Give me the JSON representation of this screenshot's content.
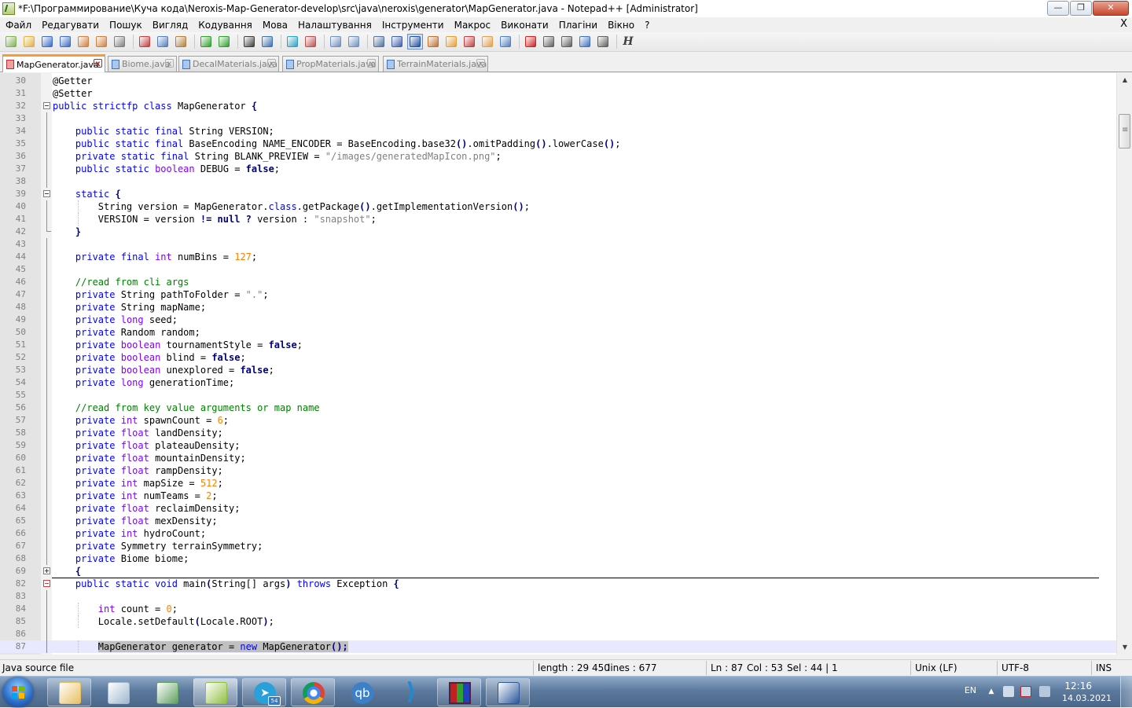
{
  "window": {
    "title": "*F:\\Программирование\\Куча кода\\Neroxis-Map-Generator-develop\\src\\java\\neroxis\\generator\\MapGenerator.java - Notepad++ [Administrator]",
    "minimize": "0",
    "maximize": "1",
    "close": "r"
  },
  "menu": [
    "Файл",
    "Редагувати",
    "Пошук",
    "Вигляд",
    "Кодування",
    "Мова",
    "Налаштування",
    "Інструменти",
    "Макрос",
    "Виконати",
    "Плагіни",
    "Вікно",
    "?"
  ],
  "menu_close": "X",
  "toolbar": [
    {
      "name": "new-file-icon",
      "color": "#7fb05a"
    },
    {
      "name": "open-file-icon",
      "color": "#e0b040"
    },
    {
      "name": "save-icon",
      "color": "#3c6cc8"
    },
    {
      "name": "save-all-icon",
      "color": "#3c6cc8"
    },
    {
      "name": "close-file-icon",
      "color": "#d08040"
    },
    {
      "name": "close-all-icon",
      "color": "#d08040"
    },
    {
      "name": "print-icon",
      "color": "#808080"
    },
    {
      "sep": true
    },
    {
      "name": "cut-icon",
      "color": "#c04040"
    },
    {
      "name": "copy-icon",
      "color": "#5080c0"
    },
    {
      "name": "paste-icon",
      "color": "#b08040"
    },
    {
      "sep": true
    },
    {
      "name": "undo-icon",
      "color": "#30a030"
    },
    {
      "name": "redo-icon",
      "color": "#30a030"
    },
    {
      "sep": true
    },
    {
      "name": "find-icon",
      "color": "#404040"
    },
    {
      "name": "replace-icon",
      "color": "#4070b0"
    },
    {
      "sep": true
    },
    {
      "name": "zoom-in-icon",
      "color": "#30a0c0"
    },
    {
      "name": "zoom-out-icon",
      "color": "#c05050"
    },
    {
      "sep": true
    },
    {
      "name": "sync-vertical-icon",
      "color": "#7090c0"
    },
    {
      "name": "sync-horizontal-icon",
      "color": "#7090c0"
    },
    {
      "sep": true
    },
    {
      "name": "word-wrap-icon",
      "color": "#5070a0"
    },
    {
      "name": "show-all-chars-icon",
      "color": "#4060b0"
    },
    {
      "name": "indent-guide-icon",
      "color": "#2050a0",
      "active": true
    },
    {
      "name": "udl-icon",
      "color": "#c07030"
    },
    {
      "name": "doc-map-icon",
      "color": "#e0a040"
    },
    {
      "name": "function-list-icon",
      "color": "#c04040"
    },
    {
      "name": "folder-workspace-icon",
      "color": "#e0a050"
    },
    {
      "name": "monitoring-icon",
      "color": "#5080c0"
    },
    {
      "sep": true
    },
    {
      "name": "record-macro-icon",
      "color": "#d02020"
    },
    {
      "name": "stop-recording-icon",
      "color": "#606060"
    },
    {
      "name": "playback-icon",
      "color": "#606060"
    },
    {
      "name": "run-macro-multiple-icon",
      "color": "#4070c0"
    },
    {
      "name": "save-macro-icon",
      "color": "#606060"
    },
    {
      "sep": true
    },
    {
      "name": "hex-editor-icon",
      "color": "#404040",
      "glyph": "H"
    }
  ],
  "tabs": [
    {
      "label": "MapGenerator.java",
      "active": true
    },
    {
      "label": "Biome.java",
      "active": false
    },
    {
      "label": "DecalMaterials.java",
      "active": false
    },
    {
      "label": "PropMaterials.java",
      "active": false
    },
    {
      "label": "TerrainMaterials.java",
      "active": false
    }
  ],
  "tab_close": "x",
  "code_lines": [
    {
      "n": "30",
      "fold": "",
      "text": [
        [
          "@Getter",
          ""
        ]
      ]
    },
    {
      "n": "31",
      "fold": "",
      "text": [
        [
          "@Setter",
          ""
        ]
      ]
    },
    {
      "n": "32",
      "fold": "minus",
      "text": [
        [
          "public strictfp class",
          "kw"
        ],
        [
          " MapGenerator ",
          ""
        ],
        [
          "{",
          "op"
        ]
      ]
    },
    {
      "n": "33",
      "fold": "line",
      "text": []
    },
    {
      "n": "34",
      "fold": "line",
      "text": [
        [
          "    public static final",
          "kw"
        ],
        [
          " String VERSION;",
          ""
        ]
      ]
    },
    {
      "n": "35",
      "fold": "line",
      "text": [
        [
          "    public static final",
          "kw"
        ],
        [
          " BaseEncoding NAME_ENCODER = BaseEncoding.base32",
          ""
        ],
        [
          "()",
          "op"
        ],
        [
          ".omitPadding",
          ""
        ],
        [
          "()",
          "op"
        ],
        [
          ".lowerCase",
          ""
        ],
        [
          "()",
          "op"
        ],
        [
          ";",
          ""
        ]
      ]
    },
    {
      "n": "36",
      "fold": "line",
      "text": [
        [
          "    private static final",
          "kw"
        ],
        [
          " String BLANK_PREVIEW = ",
          ""
        ],
        [
          "\"/images/generatedMapIcon.png\"",
          "st"
        ],
        [
          ";",
          ""
        ]
      ]
    },
    {
      "n": "37",
      "fold": "line",
      "text": [
        [
          "    public static",
          "kw"
        ],
        [
          " ",
          ""
        ],
        [
          "boolean",
          "ty"
        ],
        [
          " DEBUG = ",
          ""
        ],
        [
          "false",
          "op"
        ],
        [
          ";",
          ""
        ]
      ]
    },
    {
      "n": "38",
      "fold": "line",
      "text": []
    },
    {
      "n": "39",
      "fold": "minus",
      "text": [
        [
          "    static",
          "kw"
        ],
        [
          " ",
          ""
        ],
        [
          "{",
          "op"
        ]
      ]
    },
    {
      "n": "40",
      "fold": "line",
      "text": [
        [
          "        String version = MapGenerator.",
          ""
        ],
        [
          "class",
          "kw"
        ],
        [
          ".getPackage",
          ""
        ],
        [
          "()",
          "op"
        ],
        [
          ".getImplementationVersion",
          ""
        ],
        [
          "()",
          "op"
        ],
        [
          ";",
          ""
        ]
      ]
    },
    {
      "n": "41",
      "fold": "line",
      "text": [
        [
          "        VERSION = version ",
          ""
        ],
        [
          "!= null ?",
          "op"
        ],
        [
          " version : ",
          ""
        ],
        [
          "\"snapshot\"",
          "st"
        ],
        [
          ";",
          ""
        ]
      ]
    },
    {
      "n": "42",
      "fold": "end",
      "text": [
        [
          "    ",
          ""
        ],
        [
          "}",
          "op"
        ]
      ]
    },
    {
      "n": "43",
      "fold": "line",
      "text": []
    },
    {
      "n": "44",
      "fold": "line",
      "text": [
        [
          "    private final",
          "kw"
        ],
        [
          " ",
          ""
        ],
        [
          "int",
          "ty"
        ],
        [
          " numBins = ",
          ""
        ],
        [
          "127",
          "nm"
        ],
        [
          ";",
          ""
        ]
      ]
    },
    {
      "n": "45",
      "fold": "line",
      "text": []
    },
    {
      "n": "46",
      "fold": "line",
      "text": [
        [
          "    //read from cli args",
          "cm"
        ]
      ]
    },
    {
      "n": "47",
      "fold": "line",
      "text": [
        [
          "    private",
          "kw"
        ],
        [
          " String pathToFolder = ",
          ""
        ],
        [
          "\".\"",
          "st"
        ],
        [
          ";",
          ""
        ]
      ]
    },
    {
      "n": "48",
      "fold": "line",
      "text": [
        [
          "    private",
          "kw"
        ],
        [
          " String mapName;",
          ""
        ]
      ]
    },
    {
      "n": "49",
      "fold": "line",
      "text": [
        [
          "    private",
          "kw"
        ],
        [
          " ",
          ""
        ],
        [
          "long",
          "ty"
        ],
        [
          " seed;",
          ""
        ]
      ]
    },
    {
      "n": "50",
      "fold": "line",
      "text": [
        [
          "    private",
          "kw"
        ],
        [
          " Random random;",
          ""
        ]
      ]
    },
    {
      "n": "51",
      "fold": "line",
      "text": [
        [
          "    private",
          "kw"
        ],
        [
          " ",
          ""
        ],
        [
          "boolean",
          "ty"
        ],
        [
          " tournamentStyle = ",
          ""
        ],
        [
          "false",
          "op"
        ],
        [
          ";",
          ""
        ]
      ]
    },
    {
      "n": "52",
      "fold": "line",
      "text": [
        [
          "    private",
          "kw"
        ],
        [
          " ",
          ""
        ],
        [
          "boolean",
          "ty"
        ],
        [
          " blind = ",
          ""
        ],
        [
          "false",
          "op"
        ],
        [
          ";",
          ""
        ]
      ]
    },
    {
      "n": "53",
      "fold": "line",
      "text": [
        [
          "    private",
          "kw"
        ],
        [
          " ",
          ""
        ],
        [
          "boolean",
          "ty"
        ],
        [
          " unexplored = ",
          ""
        ],
        [
          "false",
          "op"
        ],
        [
          ";",
          ""
        ]
      ]
    },
    {
      "n": "54",
      "fold": "line",
      "text": [
        [
          "    private",
          "kw"
        ],
        [
          " ",
          ""
        ],
        [
          "long",
          "ty"
        ],
        [
          " generationTime;",
          ""
        ]
      ]
    },
    {
      "n": "55",
      "fold": "line",
      "text": []
    },
    {
      "n": "56",
      "fold": "line",
      "text": [
        [
          "    //read from key value arguments or map name",
          "cm"
        ]
      ]
    },
    {
      "n": "57",
      "fold": "line",
      "text": [
        [
          "    private",
          "kw"
        ],
        [
          " ",
          ""
        ],
        [
          "int",
          "ty"
        ],
        [
          " spawnCount = ",
          ""
        ],
        [
          "6",
          "nm"
        ],
        [
          ";",
          ""
        ]
      ]
    },
    {
      "n": "58",
      "fold": "line",
      "text": [
        [
          "    private",
          "kw"
        ],
        [
          " ",
          ""
        ],
        [
          "float",
          "ty"
        ],
        [
          " landDensity;",
          ""
        ]
      ]
    },
    {
      "n": "59",
      "fold": "line",
      "text": [
        [
          "    private",
          "kw"
        ],
        [
          " ",
          ""
        ],
        [
          "float",
          "ty"
        ],
        [
          " plateauDensity;",
          ""
        ]
      ]
    },
    {
      "n": "60",
      "fold": "line",
      "text": [
        [
          "    private",
          "kw"
        ],
        [
          " ",
          ""
        ],
        [
          "float",
          "ty"
        ],
        [
          " mountainDensity;",
          ""
        ]
      ]
    },
    {
      "n": "61",
      "fold": "line",
      "text": [
        [
          "    private",
          "kw"
        ],
        [
          " ",
          ""
        ],
        [
          "float",
          "ty"
        ],
        [
          " rampDensity;",
          ""
        ]
      ]
    },
    {
      "n": "62",
      "fold": "line",
      "text": [
        [
          "    private",
          "kw"
        ],
        [
          " ",
          ""
        ],
        [
          "int",
          "ty"
        ],
        [
          " mapSize = ",
          ""
        ],
        [
          "512",
          "nm"
        ],
        [
          ";",
          ""
        ]
      ]
    },
    {
      "n": "63",
      "fold": "line",
      "text": [
        [
          "    private",
          "kw"
        ],
        [
          " ",
          ""
        ],
        [
          "int",
          "ty"
        ],
        [
          " numTeams = ",
          ""
        ],
        [
          "2",
          "nm"
        ],
        [
          ";",
          ""
        ]
      ]
    },
    {
      "n": "64",
      "fold": "line",
      "text": [
        [
          "    private",
          "kw"
        ],
        [
          " ",
          ""
        ],
        [
          "float",
          "ty"
        ],
        [
          " reclaimDensity;",
          ""
        ]
      ]
    },
    {
      "n": "65",
      "fold": "line",
      "text": [
        [
          "    private",
          "kw"
        ],
        [
          " ",
          ""
        ],
        [
          "float",
          "ty"
        ],
        [
          " mexDensity;",
          ""
        ]
      ]
    },
    {
      "n": "66",
      "fold": "line",
      "text": [
        [
          "    private",
          "kw"
        ],
        [
          " ",
          ""
        ],
        [
          "int",
          "ty"
        ],
        [
          " hydroCount;",
          ""
        ]
      ]
    },
    {
      "n": "67",
      "fold": "line",
      "text": [
        [
          "    private",
          "kw"
        ],
        [
          " Symmetry terrainSymmetry;",
          ""
        ]
      ]
    },
    {
      "n": "68",
      "fold": "line",
      "text": [
        [
          "    private",
          "kw"
        ],
        [
          " Biome biome;",
          ""
        ]
      ]
    },
    {
      "n": "69",
      "fold": "plus",
      "sep": true,
      "text": [
        [
          "    ",
          ""
        ],
        [
          "{",
          "op"
        ]
      ]
    },
    {
      "n": "82",
      "fold": "minus-red",
      "text": [
        [
          "    public static void",
          "kw"
        ],
        [
          " main",
          ""
        ],
        [
          "(",
          "op"
        ],
        [
          "String[] args",
          ""
        ],
        [
          ")",
          "op"
        ],
        [
          " ",
          ""
        ],
        [
          "throws",
          "kw"
        ],
        [
          " Exception ",
          ""
        ],
        [
          "{",
          "op"
        ]
      ]
    },
    {
      "n": "83",
      "fold": "red",
      "text": []
    },
    {
      "n": "84",
      "fold": "red",
      "text": [
        [
          "        ",
          ""
        ],
        [
          "int",
          "ty"
        ],
        [
          " count = ",
          ""
        ],
        [
          "0",
          "nm"
        ],
        [
          ";",
          ""
        ]
      ]
    },
    {
      "n": "85",
      "fold": "red",
      "text": [
        [
          "        Locale.setDefault",
          ""
        ],
        [
          "(",
          "op"
        ],
        [
          "Locale.ROOT",
          ""
        ],
        [
          ")",
          "op"
        ],
        [
          ";",
          ""
        ]
      ]
    },
    {
      "n": "86",
      "fold": "red",
      "text": []
    },
    {
      "n": "87",
      "fold": "red",
      "cur": true,
      "text": [
        [
          "        ",
          ""
        ],
        [
          "MapGenerator generator = ",
          "sel"
        ],
        [
          "new",
          "sel kw"
        ],
        [
          " MapGenerator",
          "sel"
        ],
        [
          "();",
          "sel op"
        ]
      ]
    }
  ],
  "status": {
    "filetype": "Java source file",
    "length": "length : 29 450",
    "lines": "lines : 677",
    "ln": "Ln : 87",
    "col": "Col : 53",
    "sel": "Sel : 44 | 1",
    "eol": "Unix (LF)",
    "encoding": "UTF-8",
    "mode": "INS"
  },
  "taskbar": {
    "apps": [
      {
        "name": "explorer-icon",
        "color": "#e8c060"
      },
      {
        "name": "control-panel-icon",
        "color": "#a0b8d0"
      },
      {
        "name": "task-manager-icon",
        "color": "#60a060"
      },
      {
        "name": "notepad-plus-plus-icon",
        "color": "#90c040",
        "active": true
      },
      {
        "name": "telegram-icon",
        "color": "#2aa0da",
        "badge": "54"
      },
      {
        "name": "chrome-icon",
        "color": "#db4437"
      },
      {
        "name": "qbittorrent-icon",
        "color": "#3c80c8",
        "glyph": "qb"
      },
      {
        "name": "vscode-icon",
        "color": "#1f8ad2"
      },
      {
        "name": "winrar-icon",
        "color": "#a03080"
      },
      {
        "name": "word-document-icon",
        "color": "#2b579a"
      }
    ],
    "lang": "EN",
    "time": "12:16",
    "date": "14.03.2021"
  }
}
